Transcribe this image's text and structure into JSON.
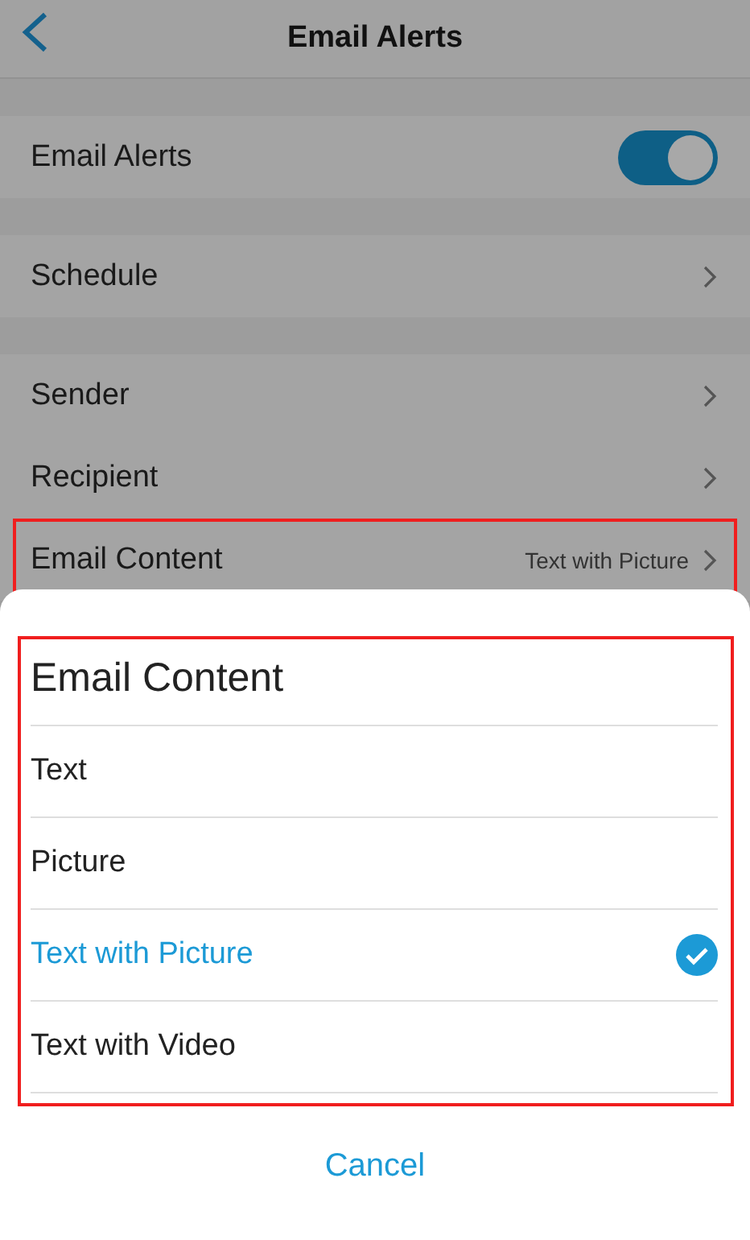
{
  "header": {
    "title": "Email Alerts"
  },
  "groups": [
    {
      "rows": [
        {
          "kind": "toggle",
          "label": "Email Alerts",
          "on": true,
          "highlighted": false
        }
      ]
    },
    {
      "rows": [
        {
          "kind": "link",
          "label": "Schedule",
          "highlighted": false
        }
      ]
    },
    {
      "rows": [
        {
          "kind": "link",
          "label": "Sender",
          "highlighted": false
        },
        {
          "kind": "link",
          "label": "Recipient",
          "highlighted": false
        },
        {
          "kind": "link",
          "label": "Email Content",
          "value": "Text with Picture",
          "highlighted": true
        }
      ]
    }
  ],
  "sheet": {
    "title": "Email Content",
    "highlighted": true,
    "options": [
      {
        "label": "Text",
        "selected": false
      },
      {
        "label": "Picture",
        "selected": false
      },
      {
        "label": "Text with Picture",
        "selected": true
      },
      {
        "label": "Text with Video",
        "selected": false
      }
    ],
    "cancel": "Cancel"
  }
}
